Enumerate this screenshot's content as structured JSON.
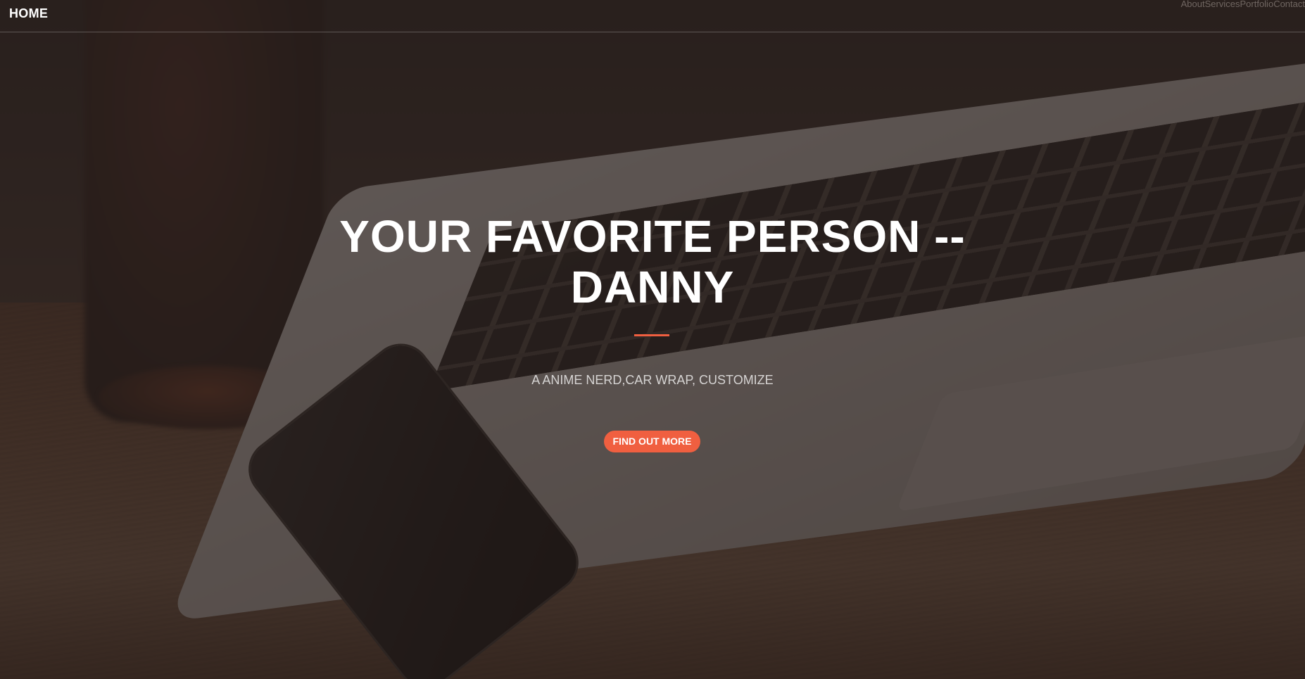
{
  "navbar": {
    "brand": "HOME",
    "links": [
      "About",
      "Services",
      "Portfolio",
      "Contact"
    ]
  },
  "hero": {
    "headline_line1": "YOUR FAVORITE PERSON --",
    "headline_line2": "DANNY",
    "tagline": "A ANIME NERD,CAR WRAP, CUSTOMIZE",
    "cta_label": "FIND OUT MORE"
  },
  "colors": {
    "accent": "#f05f40",
    "overlay": "#281f1c",
    "text": "#ffffff"
  },
  "icons": {
    "background": "laptop-phone-desk-photo"
  }
}
